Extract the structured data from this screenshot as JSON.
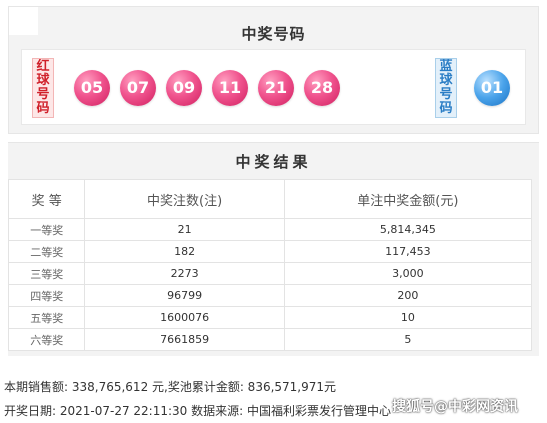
{
  "winning_numbers": {
    "title": "中奖号码",
    "red_label": "红球号码",
    "blue_label": "蓝球号码",
    "red_balls": [
      "05",
      "07",
      "09",
      "11",
      "21",
      "28"
    ],
    "blue_balls": [
      "01"
    ],
    "colors": {
      "red_ball": "#e8387a",
      "blue_ball": "#3a92dc",
      "red_label_text": "#d0202a",
      "blue_label_text": "#2a7dc5"
    }
  },
  "results": {
    "title": "中奖结果",
    "headers": [
      "奖 等",
      "中奖注数(注)",
      "单注中奖金额(元)"
    ],
    "rows": [
      {
        "level": "一等奖",
        "count": "21",
        "amount": "5,814,345"
      },
      {
        "level": "二等奖",
        "count": "182",
        "amount": "117,453"
      },
      {
        "level": "三等奖",
        "count": "2273",
        "amount": "3,000"
      },
      {
        "level": "四等奖",
        "count": "96799",
        "amount": "200"
      },
      {
        "level": "五等奖",
        "count": "1600076",
        "amount": "10"
      },
      {
        "level": "六等奖",
        "count": "7661859",
        "amount": "5"
      }
    ]
  },
  "footer": {
    "sales_line": "本期销售额: 338,765,612 元,奖池累计金额: 836,571,971元",
    "draw_line": "开奖日期: 2021-07-27 22:11:30 数据来源: 中国福利彩票发行管理中心",
    "watermark": "搜狐号@中彩网资讯"
  }
}
